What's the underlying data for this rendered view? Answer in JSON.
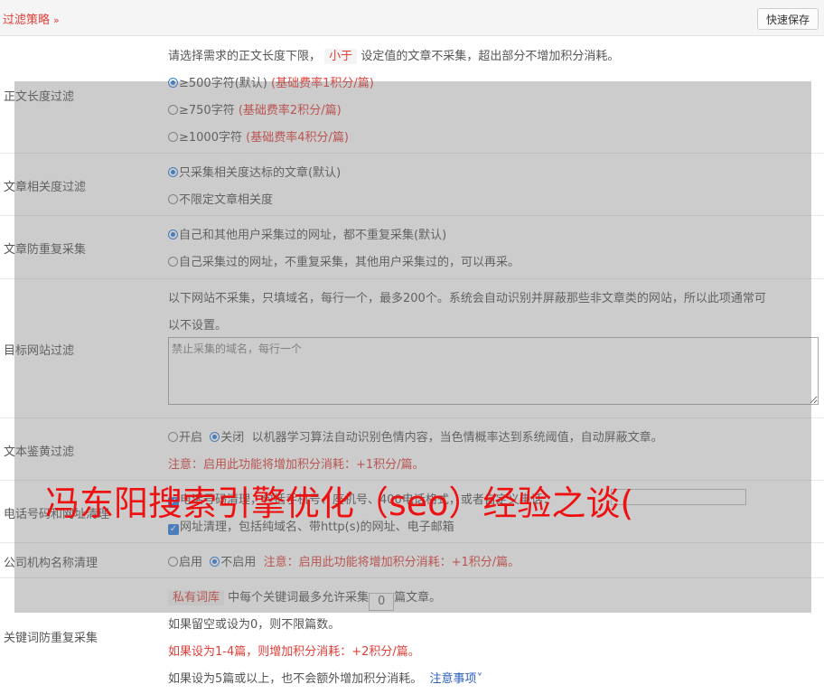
{
  "header": {
    "title": "过滤策略",
    "chevron_icon": "chevron-down-double",
    "save_label": "快速保存"
  },
  "length_filter": {
    "label": "正文长度过滤",
    "desc_prefix": "请选择需求的正文长度下限，",
    "desc_tag": "小于",
    "desc_suffix": "设定值的文章不采集，超出部分不增加积分消耗。",
    "options": [
      {
        "text": "≥500字符(默认)",
        "note": "(基础费率1积分/篇)",
        "checked": true
      },
      {
        "text": "≥750字符",
        "note": "(基础费率2积分/篇)",
        "checked": false
      },
      {
        "text": "≥1000字符",
        "note": "(基础费率4积分/篇)",
        "checked": false
      }
    ]
  },
  "relevance_filter": {
    "label": "文章相关度过滤",
    "options": [
      {
        "text": "只采集相关度达标的文章(默认)",
        "checked": true
      },
      {
        "text": "不限定文章相关度",
        "checked": false
      }
    ]
  },
  "dedupe": {
    "label": "文章防重复采集",
    "options": [
      {
        "text": "自己和其他用户采集过的网址，都不重复采集(默认)",
        "checked": true
      },
      {
        "text": "自己采集过的网址，不重复采集，其他用户采集过的，可以再采。",
        "checked": false
      }
    ]
  },
  "site_filter": {
    "label": "目标网站过滤",
    "desc_line1": "以下网站不采集，只填域名，每行一个，最多200个。系统会自动识别并屏蔽那些非文章类的网站，所以此项通常可",
    "desc_line2": "以不设置。",
    "placeholder": "禁止采集的域名，每行一个"
  },
  "porn_filter": {
    "label": "文本鉴黄过滤",
    "on_label": "开启",
    "off_label": "关闭",
    "desc": "以机器学习算法自动识别色情内容，当色情概率达到系统阈值，自动屏蔽文章。",
    "note": "注意：启用此功能将增加积分消耗：+1积分/篇。"
  },
  "phone_clean": {
    "label": "电话号码和网址清理",
    "line1": "电话号码清理，包括手机号、座机号、400电话格式，或者自定义电话：",
    "line2": "网址清理，包括纯域名、带http(s)的网址、电子邮箱"
  },
  "org_clean": {
    "label": "公司机构名称清理",
    "on_label": "启用",
    "off_label": "不启用",
    "note": "注意：启用此功能将增加积分消耗：+1积分/篇。"
  },
  "keyword_dedupe": {
    "label": "关键词防重复采集",
    "tag": "私有词库",
    "line1_mid": "中每个关键词最多允许采集",
    "count": "0",
    "line1_end": "篇文章。",
    "line2": "如果留空或设为0，则不限篇数。",
    "line3": "如果设为1-4篇，则增加积分消耗：+2积分/篇。",
    "line4": "如果设为5篇或以上，也不会额外增加积分消耗。",
    "notes_link": "注意事项"
  },
  "watermark": "冯东阳搜索引擎优化（seo）经验之谈("
}
